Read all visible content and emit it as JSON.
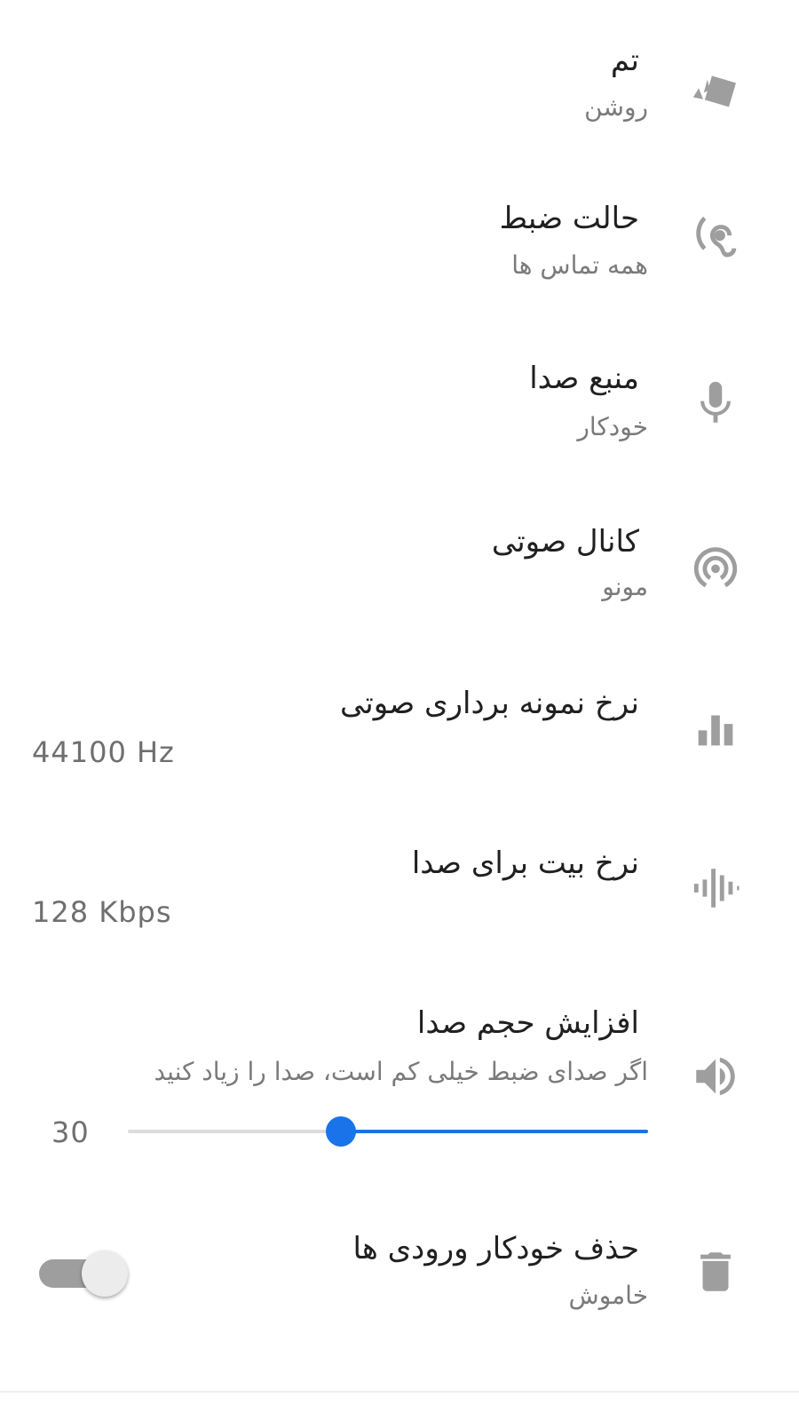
{
  "settings": {
    "theme": {
      "title": "تم",
      "summary": "روشن",
      "icon": "palette-icon"
    },
    "recording_mode": {
      "title": "حالت ضبط",
      "summary": "همه تماس ها",
      "icon": "ear-icon"
    },
    "audio_source": {
      "title": "منبع صدا",
      "summary": "خودکار",
      "icon": "microphone-icon"
    },
    "audio_channel": {
      "title": "کانال صوتی",
      "summary": "مونو",
      "icon": "broadcast-icon"
    },
    "sample_rate": {
      "title": "نرخ نمونه برداری صوتی",
      "value": "44100 Hz",
      "icon": "bar-chart-icon"
    },
    "bitrate": {
      "title": "نرخ بیت برای صدا",
      "value": "128 Kbps",
      "icon": "waveform-icon"
    },
    "volume_boost": {
      "title": "افزایش حجم صدا",
      "summary": "اگر صدای ضبط خیلی کم است، صدا را زیاد کنید",
      "value": "30",
      "slider_fraction": 0.41,
      "icon": "speaker-icon"
    },
    "auto_delete": {
      "title": "حذف خودکار ورودی ها",
      "summary": "خاموش",
      "enabled": false,
      "icon": "trash-icon"
    }
  },
  "colors": {
    "accent": "#1a73e8",
    "icon": "#9e9e9e",
    "title_text": "#202020",
    "summary_text": "#7a7a7a"
  }
}
